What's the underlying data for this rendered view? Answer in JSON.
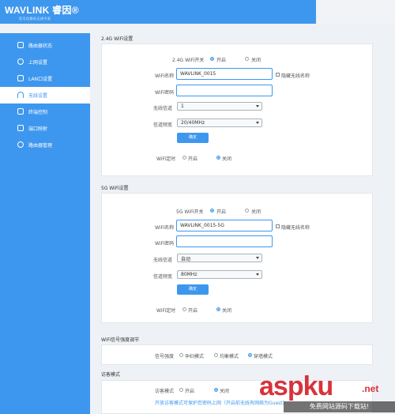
{
  "header": {
    "brand": "WAVLINK 睿因®",
    "tagline": "您可信赖的无线专家"
  },
  "sidebar": {
    "items": [
      {
        "label": "路由器状态",
        "icon": "status-icon",
        "active": false
      },
      {
        "label": "上网设置",
        "icon": "globe-icon",
        "active": false
      },
      {
        "label": "LAN口设置",
        "icon": "lan-port-icon",
        "active": false
      },
      {
        "label": "无线设置",
        "icon": "wifi-icon",
        "active": true
      },
      {
        "label": "终端控制",
        "icon": "chart-icon",
        "active": false
      },
      {
        "label": "端口映射",
        "icon": "port-map-icon",
        "active": false
      },
      {
        "label": "路由器管理",
        "icon": "gear-icon",
        "active": false
      }
    ]
  },
  "wifi24": {
    "section_title": "2.4G WiFi设置",
    "switch_label": "2.4G WiFi开关",
    "on": "开启",
    "off": "关闭",
    "name_label": "WiFi名称",
    "name_value": "WAVLINK_0015",
    "hide_label": "隐藏无线名称",
    "pwd_label": "WiFi密码",
    "pwd_value": "",
    "channel_label": "无线信道",
    "channel_value": "1",
    "bandwidth_label": "信道频宽",
    "bandwidth_value": "20/40MHz",
    "confirm": "确定",
    "timer_label": "WiFi定时",
    "timer_on": "开启",
    "timer_off": "关闭"
  },
  "wifi5": {
    "section_title": "5G WiFi设置",
    "switch_label": "5G WiFi开关",
    "on": "开启",
    "off": "关闭",
    "name_label": "WiFi名称",
    "name_value": "WAVLINK_0015-5G",
    "hide_label": "隐藏无线名称",
    "pwd_label": "WiFi密码",
    "pwd_value": "",
    "channel_label": "无线信道",
    "channel_value": "自动",
    "bandwidth_label": "信道频宽",
    "bandwidth_value": "80MHz",
    "confirm": "确定",
    "timer_label": "WiFi定时",
    "timer_on": "开启",
    "timer_off": "关闭"
  },
  "signal": {
    "section_title": "WiFi信号强度调节",
    "label": "信号强度",
    "options": [
      "孕妇模式",
      "均衡模式",
      "穿墙模式"
    ],
    "selected": "穿墙模式"
  },
  "guest": {
    "section_title": "访客模式",
    "label": "访客模式",
    "on": "开启",
    "off": "关闭",
    "note": "开放访客模式可保护您密码上网（开启前无线有网络为Guest）"
  },
  "watermark": {
    "main": "aspku",
    "net": ".net",
    "sub": "免费网站源码下载站!"
  }
}
